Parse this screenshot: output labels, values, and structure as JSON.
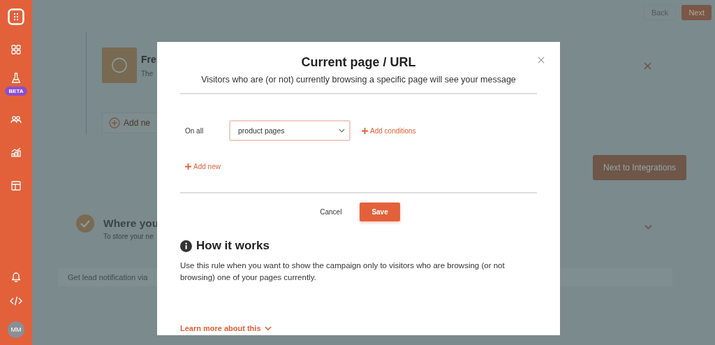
{
  "sidebar": {
    "beta_badge": "BETA",
    "avatar": "MM"
  },
  "top_buttons": {
    "back": "Back",
    "next": "Next"
  },
  "campaign_card": {
    "title": "Fre",
    "subtitle": "The",
    "add_button": "Add ne",
    "next_button": "Next to Integrations"
  },
  "storage_section": {
    "title": "Where you",
    "subtitle": "To store your ne",
    "notification": "Get lead notification via"
  },
  "modal": {
    "title": "Current page / URL",
    "subtitle": "Visitors who are (or not) currently browsing a specific page will see your message",
    "rule": {
      "label": "On all",
      "select_value": "product pages",
      "add_conditions": "Add conditions"
    },
    "add_new": "Add new",
    "buttons": {
      "cancel": "Cancel",
      "save": "Save"
    },
    "help": {
      "title": "How it works",
      "text": "Use this rule when you want to show the campaign only to visitors who are browsing (or not browsing) one of your pages currently.",
      "link": "Learn more about this"
    }
  }
}
